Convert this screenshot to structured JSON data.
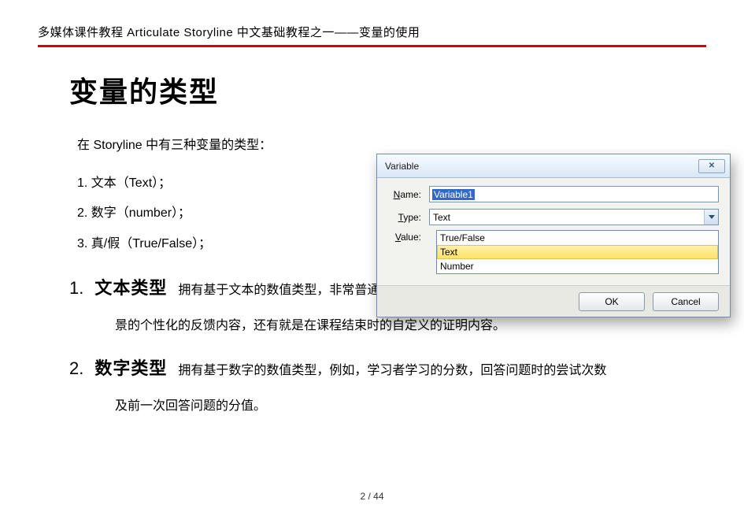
{
  "header": {
    "text": "多媒体课件教程  Articulate  Storyline   中文基础教程之一——变量的使用"
  },
  "title": "变量的类型",
  "intro": "在 Storyline 中有三种变量的类型：",
  "types": [
    "1. 文本（Text）；",
    "2. 数字（number）；",
    "3. 真/假（True/False）；"
  ],
  "sections": [
    {
      "num": "1.",
      "title": "文本类型",
      "body_inline": "拥有基于文本的数值类型，非常普通的例子就是学习者的名字，及对于一个情",
      "body_cont": "景的个性化的反馈内容，还有就是在课程结束时的自定义的证明内容。"
    },
    {
      "num": "2.",
      "title": "数字类型",
      "body_inline": "拥有基于数字的数值类型，例如，学习者学习的分数，回答问题时的尝试次数",
      "body_cont": "及前一次回答问题的分值。"
    }
  ],
  "dialog": {
    "title": "Variable",
    "labels": {
      "name": "Name:",
      "type": "Type:",
      "value": "Value:"
    },
    "name_value": "Variable1",
    "combo_value": "Text",
    "options": [
      "True/False",
      "Text",
      "Number"
    ],
    "buttons": {
      "ok": "OK",
      "cancel": "Cancel"
    }
  },
  "pager": "2 / 44",
  "corner": ""
}
